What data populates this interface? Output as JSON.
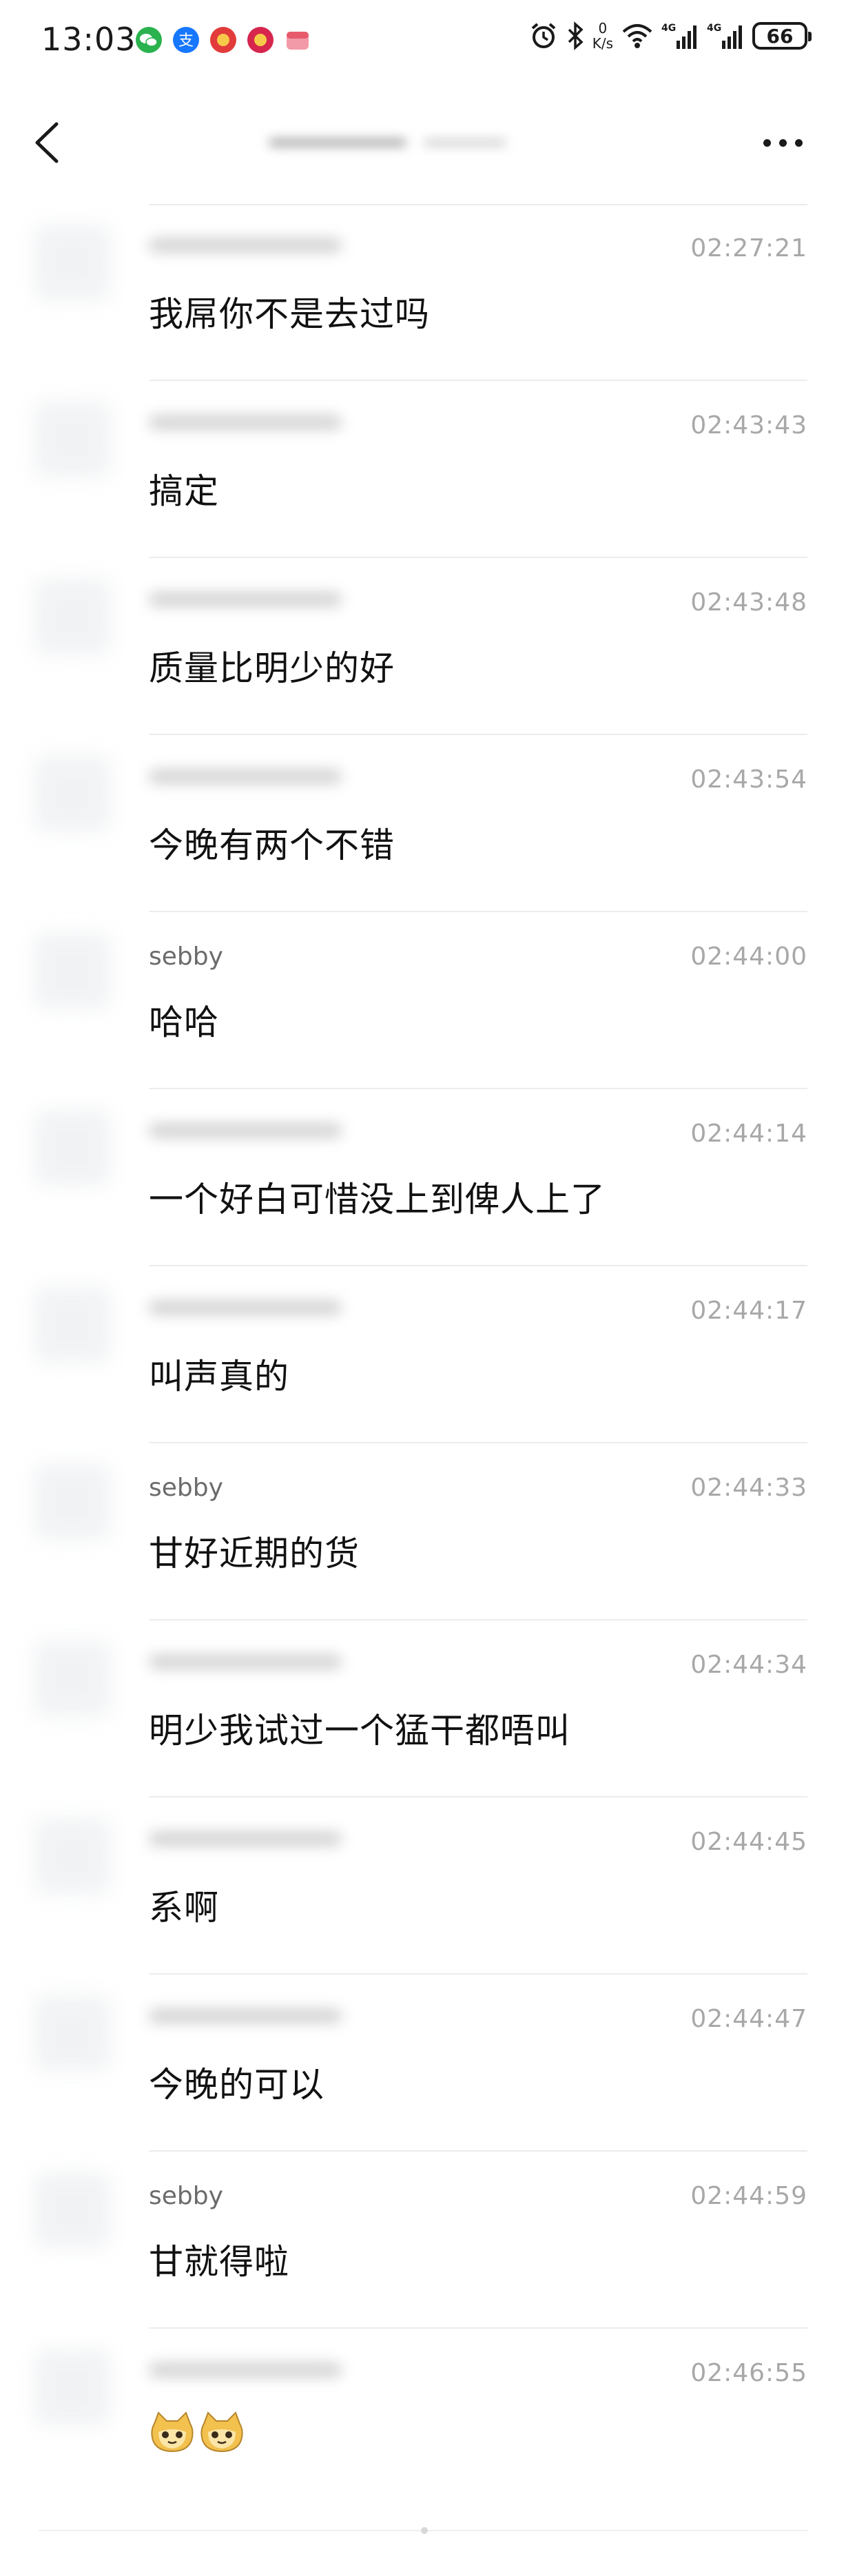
{
  "status_bar": {
    "time": "13:03",
    "net_speed_value": "0",
    "net_speed_unit": "K/s",
    "battery": "66",
    "icons": [
      "wechat-icon",
      "alipay-icon",
      "app-icon-red",
      "app-icon-red-2",
      "app-icon-pink",
      "alarm-icon",
      "bluetooth-icon",
      "wifi-icon",
      "signal-4g-icon",
      "signal-4g-icon-2"
    ]
  },
  "nav": {
    "back_icon": "chevron-left-icon",
    "more_icon": "more-dots-icon"
  },
  "messages": [
    {
      "sender": "",
      "time": "02:27:21",
      "text": "我屌你不是去过吗"
    },
    {
      "sender": "",
      "time": "02:43:43",
      "text": "搞定"
    },
    {
      "sender": "",
      "time": "02:43:48",
      "text": "质量比明少的好"
    },
    {
      "sender": "",
      "time": "02:43:54",
      "text": "今晚有两个不错"
    },
    {
      "sender": "sebby",
      "time": "02:44:00",
      "text": "哈哈"
    },
    {
      "sender": "",
      "time": "02:44:14",
      "text": "一个好白可惜没上到俾人上了"
    },
    {
      "sender": "",
      "time": "02:44:17",
      "text": "叫声真的"
    },
    {
      "sender": "sebby",
      "time": "02:44:33",
      "text": "甘好近期的货"
    },
    {
      "sender": "",
      "time": "02:44:34",
      "text": "明少我试过一个猛干都唔叫"
    },
    {
      "sender": "",
      "time": "02:44:45",
      "text": "系啊"
    },
    {
      "sender": "",
      "time": "02:44:47",
      "text": "今晚的可以"
    },
    {
      "sender": "sebby",
      "time": "02:44:59",
      "text": "甘就得啦"
    },
    {
      "sender": "",
      "time": "02:46:55",
      "text": "",
      "emoji": [
        "cat-emoji",
        "cat-emoji"
      ]
    }
  ],
  "colors": {
    "background": "#ffffff",
    "text": "#111111",
    "timestamp": "#a8a8a8",
    "divider": "#ececec"
  }
}
